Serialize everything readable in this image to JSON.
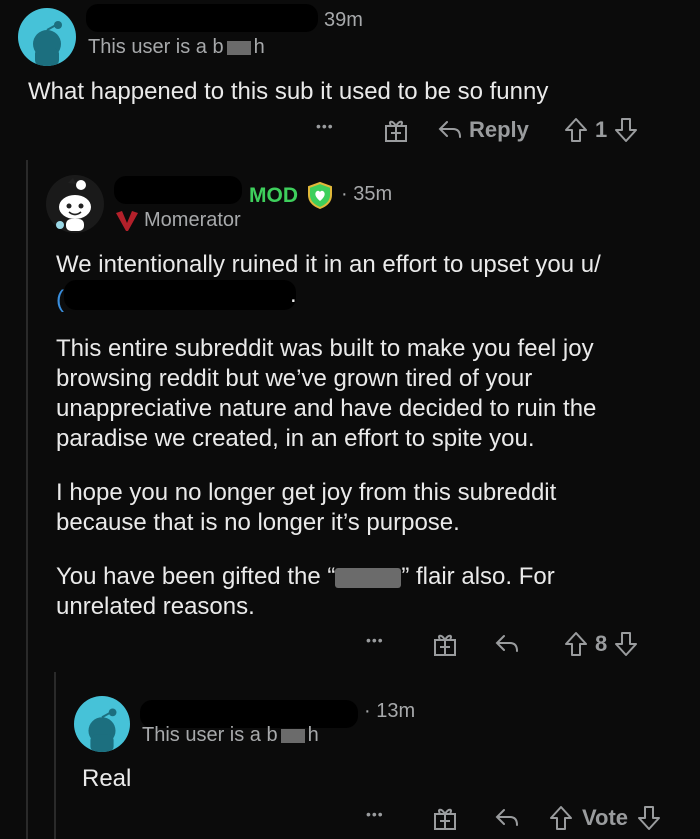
{
  "comment1": {
    "time": "39m",
    "flair": "This user is a b",
    "flair_end": "h",
    "body": "What happened to this sub it used to be so funny",
    "reply_label": "Reply",
    "votes": "1",
    "more": "•••"
  },
  "comment2": {
    "mod_badge": "MOD",
    "time": "· 35m",
    "flair": "Momerator",
    "p1": "We intentionally ruined it in an effort to upset you u/",
    "p1_end": ".",
    "p2": "This entire subreddit was built to make you feel joy browsing reddit but we’ve grown tired of your unappreciative nature and have decided to ruin the paradise we created, in an effort to spite you.",
    "p3": "I hope you no longer get joy from this subreddit because that is no longer it’s purpose.",
    "p4_start": "You have been gifted the “",
    "p4_end": "” flair also. For unrelated reasons.",
    "votes": "8",
    "more": "•••"
  },
  "comment3": {
    "time": "· 13m",
    "flair": "This user is a b",
    "flair_end": "h",
    "body": "Real",
    "vote_label": "Vote",
    "more": "•••"
  },
  "colors": {
    "background": "#0b0b0b",
    "mod_green": "#3ecf5c",
    "link_blue": "#3a8fde",
    "avatar_cyan": "#46c2d8"
  }
}
